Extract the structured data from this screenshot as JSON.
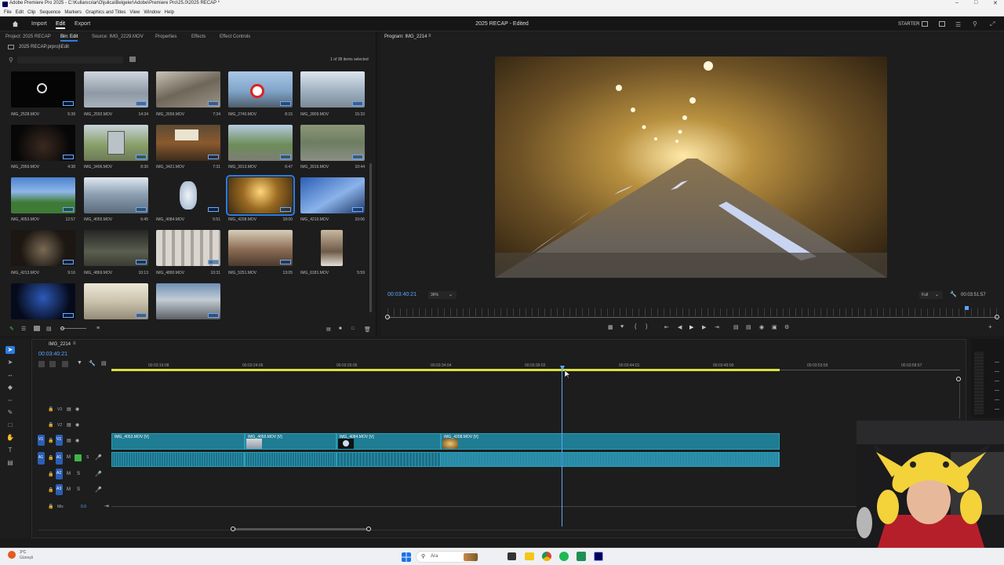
{
  "window": {
    "title": "Adobe Premiere Pro 2025 - C:\\Kullanıcılar\\O\\julica\\Belgeler\\Adobe\\Premiere Pro\\25.0\\2025 RECAP *"
  },
  "menu": [
    "File",
    "Edit",
    "Clip",
    "Sequence",
    "Markers",
    "Graphics and Titles",
    "View",
    "Window",
    "Help"
  ],
  "header": {
    "home": "Home",
    "import": "Import",
    "edit": "Edit",
    "export": "Export",
    "project_title": "2025 RECAP - Edited",
    "workspace": "STARTER"
  },
  "project_panel": {
    "tabs": [
      "Project: 2025 RECAP",
      "Bin: Edit",
      "Source: IMG_2229.MOV",
      "Properties",
      "Effects",
      "Effect Controls"
    ],
    "path": "2025 RECAP.prproj\\Edit",
    "items_selected": "1 of 38 items selected",
    "clips": [
      {
        "name": "IMG_2528.MOV",
        "dur": "5:39"
      },
      {
        "name": "IMG_2592.MOV",
        "dur": "14:34"
      },
      {
        "name": "IMG_2656.MOV",
        "dur": "7:34"
      },
      {
        "name": "IMG_2740.MOV",
        "dur": "8:15"
      },
      {
        "name": "IMG_2809.MOV",
        "dur": "15:33"
      },
      {
        "name": "IMG_2959.MOV",
        "dur": "4:38"
      },
      {
        "name": "IMG_3406.MOV",
        "dur": "8:30"
      },
      {
        "name": "IMG_3421.MOV",
        "dur": "7:31"
      },
      {
        "name": "IMG_3913.MOV",
        "dur": "6:47"
      },
      {
        "name": "IMG_3916.MOV",
        "dur": "10:44"
      },
      {
        "name": "IMG_4053.MOV",
        "dur": "12:57"
      },
      {
        "name": "IMG_4055.MOV",
        "dur": "6:45"
      },
      {
        "name": "IMG_4084.MOV",
        "dur": "5:51"
      },
      {
        "name": "IMG_4208.MOV",
        "dur": "18:00"
      },
      {
        "name": "IMG_4210.MOV",
        "dur": "10:06"
      },
      {
        "name": "IMG_4213.MOV",
        "dur": "9:16"
      },
      {
        "name": "IMG_4869.MOV",
        "dur": "10:13"
      },
      {
        "name": "IMG_4890.MOV",
        "dur": "10:31"
      },
      {
        "name": "IMG_5251.MOV",
        "dur": "13:05"
      },
      {
        "name": "IMG_6181.MOV",
        "dur": "5:59"
      },
      {
        "name": "",
        "dur": ""
      },
      {
        "name": "",
        "dur": ""
      },
      {
        "name": "",
        "dur": ""
      }
    ]
  },
  "program_panel": {
    "tab": "Program: IMG_2214",
    "timecode": "00:03:40:21",
    "zoom": "36%",
    "quality": "Full",
    "duration": "00:03:51:57"
  },
  "timeline": {
    "tab": "IMG_2214",
    "timecode": "00:03:40:21",
    "ruler": [
      "00:03:19:08",
      "00:03:24:06",
      "00:03:29:05",
      "00:03:34:04",
      "00:03:39:03",
      "00:03:44:01",
      "00:03:49:00",
      "00:03:53:59",
      "00:03:58:57"
    ],
    "tracks": {
      "v3": "V3",
      "v2": "V2",
      "v1": "V1",
      "a1": "A1",
      "a2": "A2",
      "a3": "A3",
      "mix": "Mix",
      "mix_val": "0.0"
    },
    "clips": [
      "IMG_4053.MOV [V]",
      "IMG_4055.MOV [V]",
      "IMG_4084.MOV [V]",
      "IMG_4208.MOV [V]"
    ]
  },
  "taskbar": {
    "weather": "3°C",
    "weather_sub": "Güneşli",
    "search": "Ara"
  }
}
